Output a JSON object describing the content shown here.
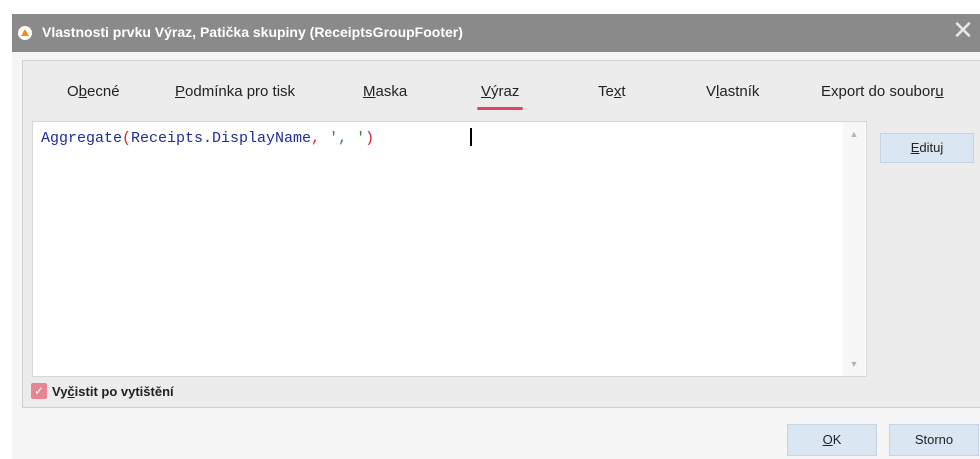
{
  "window": {
    "title": "Vlastnosti prvku Výraz, Patička skupiny (ReceiptsGroupFooter)",
    "close_symbol": "✕"
  },
  "tabs": [
    {
      "label_pre": "O",
      "label_key": "b",
      "label_post": "ecné"
    },
    {
      "label_pre": "",
      "label_key": "P",
      "label_post": "odmínka pro tisk"
    },
    {
      "label_pre": "",
      "label_key": "M",
      "label_post": "aska"
    },
    {
      "label_pre": "",
      "label_key": "V",
      "label_post": "ýraz"
    },
    {
      "label_pre": "Te",
      "label_key": "x",
      "label_post": "t"
    },
    {
      "label_pre": "V",
      "label_key": "l",
      "label_post": "astník"
    },
    {
      "label_pre": "Export do soubor",
      "label_key": "u",
      "label_post": ""
    }
  ],
  "active_tab": "Výraz",
  "editor": {
    "code": {
      "fn": "Aggregate",
      "open": "(",
      "arg": "Receipts.DisplayName",
      "comma": ", ",
      "str": "', '",
      "close": ")"
    }
  },
  "edit_button": {
    "key": "E",
    "rest": "dituj"
  },
  "checkbox": {
    "checked": true,
    "label_pre": "Vy",
    "label_key": "č",
    "label_post": "istit po vytištění"
  },
  "buttons": {
    "ok": {
      "key": "O",
      "rest": "K"
    },
    "cancel": "Storno"
  },
  "colors": {
    "accent": "#e0455c",
    "titlebar": "#8a8a8a",
    "button": "#dbe6f3",
    "code_function": "#1c2c9c",
    "code_paren": "#d0262a",
    "code_string": "#2e8b2e"
  },
  "icons": [
    "app-icon",
    "close-icon",
    "checkmark-icon",
    "scroll-up-icon",
    "scroll-down-icon"
  ]
}
